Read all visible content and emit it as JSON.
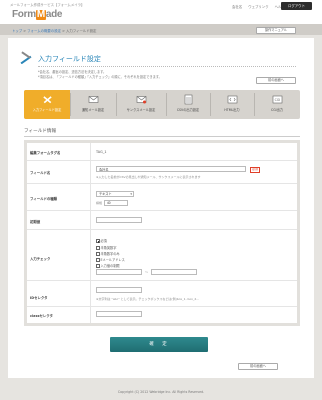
{
  "header": {
    "service_name": "メールフォーム作成サービス【フォームメイラ】",
    "logo_text": "Form",
    "logo_mark": "M",
    "logo_text_end": "ade",
    "links": [
      "会社名",
      "ウェブリンク",
      "ヘルプ"
    ],
    "logout_label": "ログアウト"
  },
  "breadcrumb": {
    "items": [
      "トップ",
      "フォームの概要の設定",
      "入力フィールド設定"
    ],
    "separator": ">"
  },
  "manual_button": "操作マニュアル",
  "page": {
    "title": "入力フィールド設定",
    "description_1": "*会社名、趣旨の設定、送信方法を決定します。",
    "description_2": "*項目名は、「フィールドの種類」「入力チェック」の順に、それぞれを設定できます。",
    "prev_button": "前の画面へ"
  },
  "tabs": [
    {
      "label": "入力フィールド設定",
      "icon": "pencil-wrench-icon",
      "active": true
    },
    {
      "label": "通知メール設定",
      "icon": "mail-icon",
      "active": false
    },
    {
      "label": "サンクスメール設定",
      "icon": "envelope-icon",
      "active": false
    },
    {
      "label": "CSVの出力設定",
      "icon": "csv-icon",
      "active": false
    },
    {
      "label": "HTML出力",
      "icon": "html-icon",
      "active": false
    },
    {
      "label": "CGI出力",
      "icon": "cgi-icon",
      "active": false
    }
  ],
  "section": {
    "title": "フィールド情報"
  },
  "form": {
    "tag_label": "編集フォームタグ名",
    "tag_value": "TAG_1",
    "field_name_label": "フィールド名",
    "field_name_value": "会社名",
    "required_badge": "必須",
    "field_name_note": "※入力した名前がCSVの見出しや通知メール、サンクスメールに表示されます",
    "field_type_label": "フィールドの種類",
    "field_type_value": "テキスト",
    "width_label": "横幅",
    "width_value": "40",
    "initial_label": "初期値",
    "initial_value": "",
    "check_label": "入力チェック",
    "checks": [
      {
        "label": "必須",
        "checked": true
      },
      {
        "label": "半角英数字",
        "checked": false
      },
      {
        "label": "半角数字のみ",
        "checked": false
      },
      {
        "label": "Eメールアドレス",
        "checked": false
      },
      {
        "label": "入力値の制限",
        "checked": false
      }
    ],
    "range_sep": "〜",
    "id_label": "IDセレクタ",
    "id_note": "※文字列は \"abc\" として表示。チェックボックスなどは(例)box_1, box_2...",
    "class_label": "classセレクタ",
    "submit_label": "確　定"
  },
  "footer": {
    "prev_button": "前の画面へ",
    "copyright": "Copyright (C) 2012 Webridge Inc. All Rights Reserved."
  },
  "colors": {
    "accent": "#f0ad2a",
    "title": "#2a86b8",
    "submit": "#1f6d72"
  }
}
